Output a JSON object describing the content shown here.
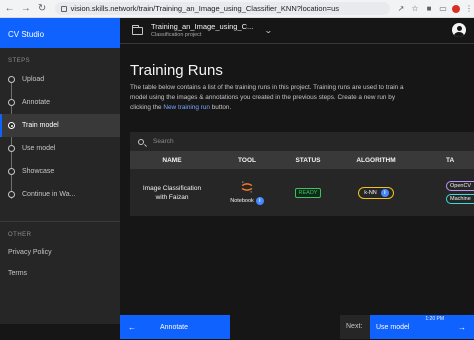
{
  "browser": {
    "url": "vision.skills.network/train/Training_an_Image_using_Classifier_KNN?location=us"
  },
  "sidebar": {
    "brand": "CV Studio",
    "steps_heading": "STEPS",
    "steps": [
      {
        "label": "Upload"
      },
      {
        "label": "Annotate"
      },
      {
        "label": "Train model"
      },
      {
        "label": "Use model"
      },
      {
        "label": "Showcase"
      },
      {
        "label": "Continue in Wa..."
      }
    ],
    "other_heading": "OTHER",
    "links": [
      {
        "label": "Privacy Policy"
      },
      {
        "label": "Terms"
      }
    ]
  },
  "header": {
    "project_name": "Training_an_Image_using_C...",
    "project_type": "Classification project"
  },
  "main": {
    "title": "Training Runs",
    "description_pre": "The table below contains a list of the training runs in this project. Training runs are used to train a model using the images & annotations you created in the previous steps. Create a new run by clicking the ",
    "description_link": "New training run",
    "description_post": " button.",
    "search_placeholder": "Search",
    "columns": [
      "NAME",
      "TOOL",
      "STATUS",
      "ALGORITHM",
      "TA"
    ],
    "rows": [
      {
        "name": "Image Classification with Faizan",
        "tool": "Notebook",
        "status": "READY",
        "algorithm": "k-NN",
        "tags": [
          "OpenCV",
          "Machine"
        ]
      }
    ]
  },
  "footer": {
    "prev_label": "Annotate",
    "next_prefix": "Next:",
    "next_label": "Use model"
  },
  "taskbar": {
    "time": "1:20 PM"
  }
}
